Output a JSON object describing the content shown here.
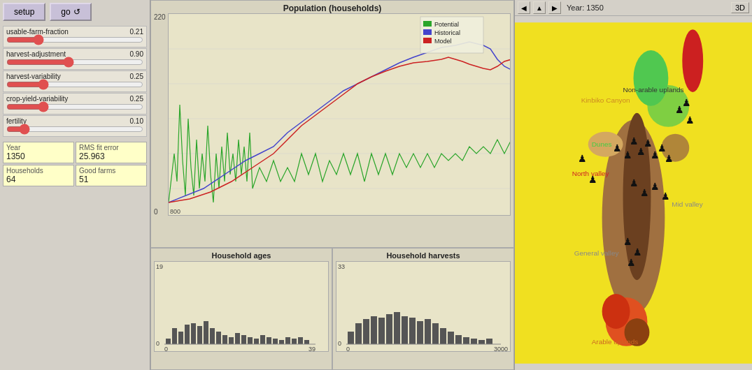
{
  "buttons": {
    "setup": "setup",
    "go": "go",
    "go_icon": "↺"
  },
  "sliders": [
    {
      "id": "usable-farm-fraction",
      "label": "usable-farm-fraction",
      "value": 0.21,
      "min": 0,
      "max": 1,
      "pct": 21
    },
    {
      "id": "harvest-adjustment",
      "label": "harvest-adjustment",
      "value": 0.9,
      "min": 0,
      "max": 2,
      "pct": 45
    },
    {
      "id": "harvest-variability",
      "label": "harvest-variability",
      "value": 0.25,
      "min": 0,
      "max": 1,
      "pct": 25
    },
    {
      "id": "crop-yield-variability",
      "label": "crop-yield-variability",
      "value": 0.25,
      "min": 0,
      "max": 1,
      "pct": 25
    },
    {
      "id": "fertility",
      "label": "fertility",
      "value": 0.1,
      "min": 0,
      "max": 1,
      "pct": 10
    }
  ],
  "stats": {
    "year_label": "Year",
    "year_value": "1350",
    "rms_label": "RMS fit error",
    "rms_value": "25.963",
    "households_label": "Households",
    "households_value": "64",
    "good_farms_label": "Good farms",
    "good_farms_value": "51"
  },
  "main_chart": {
    "title": "Population (households)",
    "y_max": "220",
    "y_min": "0",
    "x_min": "800",
    "x_max": "1350",
    "legend": [
      {
        "label": "Potential",
        "color": "#2aa52a"
      },
      {
        "label": "Historical",
        "color": "#4444cc"
      },
      {
        "label": "Model",
        "color": "#cc2222"
      }
    ]
  },
  "bottom_charts": [
    {
      "id": "household-ages",
      "title": "Household ages",
      "y_max": "19",
      "y_min": "0",
      "x_min": "0",
      "x_max": "39"
    },
    {
      "id": "household-harvests",
      "title": "Household harvests",
      "y_max": "33",
      "y_min": "0",
      "x_min": "0",
      "x_max": "3000"
    }
  ],
  "map": {
    "title": "Year: 1350",
    "btn_3d": "3D",
    "labels": {
      "kinbiko": "Kinbiko Canyon",
      "non_arable": "Non-arable uplands",
      "dunes": "Dunes",
      "north_valley": "North valley",
      "mid_valley": "Mid valley",
      "general_valley": "General valley",
      "arable_uplands": "Arable uplands"
    }
  },
  "colors": {
    "yellow": "#f0e020",
    "brown": "#a07040",
    "dark_brown": "#6b4020",
    "orange_red": "#e05020",
    "green": "#50c850",
    "red": "#cc2222",
    "chart_bg": "#e8e4c8",
    "panel_bg": "#d4d0c8"
  }
}
